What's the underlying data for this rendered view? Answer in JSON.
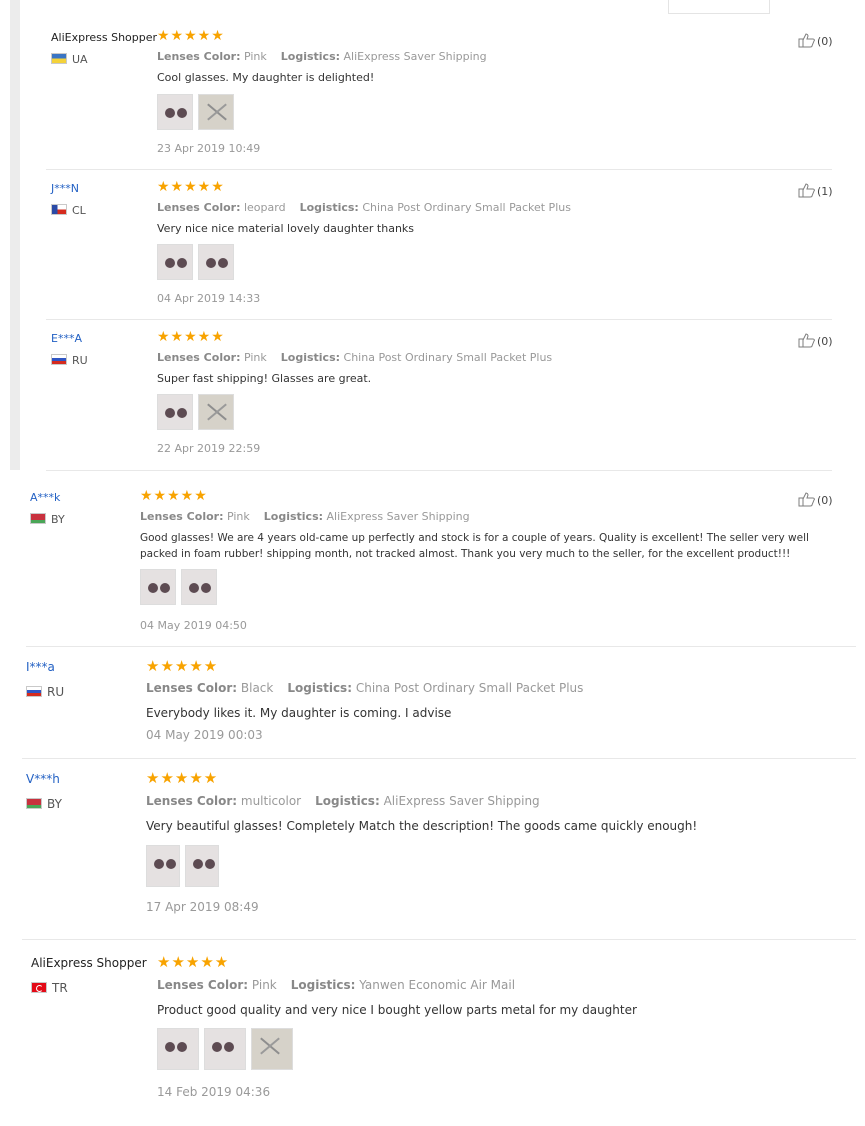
{
  "reviews": [
    {
      "name": "AliExpress Shopper",
      "country": "UA",
      "stars": "★★★★★",
      "lenses_label": "Lenses Color:",
      "lenses_value": "Pink",
      "logistics_label": "Logistics:",
      "logistics_value": "AliExpress Saver Shipping",
      "text": "Cool glasses. My daughter is delighted!",
      "photos": 2,
      "date": "23 Apr 2019 10:49",
      "likes": "(0)"
    },
    {
      "name": "J***N",
      "country": "CL",
      "stars": "★★★★★",
      "lenses_label": "Lenses Color:",
      "lenses_value": "leopard",
      "logistics_label": "Logistics:",
      "logistics_value": "China Post Ordinary Small Packet Plus",
      "text": "Very nice nice material lovely daughter thanks",
      "photos": 2,
      "date": "04 Apr 2019 14:33",
      "likes": "(1)"
    },
    {
      "name": "E***A",
      "country": "RU",
      "stars": "★★★★★",
      "lenses_label": "Lenses Color:",
      "lenses_value": "Pink",
      "logistics_label": "Logistics:",
      "logistics_value": "China Post Ordinary Small Packet Plus",
      "text": "Super fast shipping! Glasses are great.",
      "photos": 2,
      "date": "22 Apr 2019 22:59",
      "likes": "(0)"
    },
    {
      "name": "A***k",
      "country": "BY",
      "stars": "★★★★★",
      "lenses_label": "Lenses Color:",
      "lenses_value": "Pink",
      "logistics_label": "Logistics:",
      "logistics_value": "AliExpress Saver Shipping",
      "text": "Good glasses! We are 4 years old-came up perfectly and stock is for a couple of years. Quality is excellent! The seller very well packed in foam rubber! shipping month, not tracked almost. Thank you very much to the seller, for the excellent product!!!",
      "photos": 2,
      "date": "04 May 2019 04:50",
      "likes": "(0)"
    },
    {
      "name": "I***a",
      "country": "RU",
      "stars": "★★★★★",
      "lenses_label": "Lenses Color:",
      "lenses_value": "Black",
      "logistics_label": "Logistics:",
      "logistics_value": "China Post Ordinary Small Packet Plus",
      "text": "Everybody likes it. My daughter is coming. I advise",
      "photos": 0,
      "date": "04 May 2019 00:03"
    },
    {
      "name": "V***h",
      "country": "BY",
      "stars": "★★★★★",
      "lenses_label": "Lenses Color:",
      "lenses_value": "multicolor",
      "logistics_label": "Logistics:",
      "logistics_value": "AliExpress Saver Shipping",
      "text": "Very beautiful glasses! Completely Match the description! The goods came quickly enough!",
      "photos": 2,
      "date": "17 Apr 2019 08:49"
    },
    {
      "name": "AliExpress Shopper",
      "country": "TR",
      "stars": "★★★★★",
      "lenses_label": "Lenses Color:",
      "lenses_value": "Pink",
      "logistics_label": "Logistics:",
      "logistics_value": "Yanwen Economic Air Mail",
      "text": "Product good quality and very nice I bought yellow parts metal for my daughter",
      "photos": 3,
      "date": "14 Feb 2019 04:36"
    }
  ],
  "colors": {
    "star": "#f8a300",
    "user_name_link": "#2361c4",
    "meta_text": "#999999"
  },
  "icons": {
    "like": "thumbs-up-icon"
  }
}
